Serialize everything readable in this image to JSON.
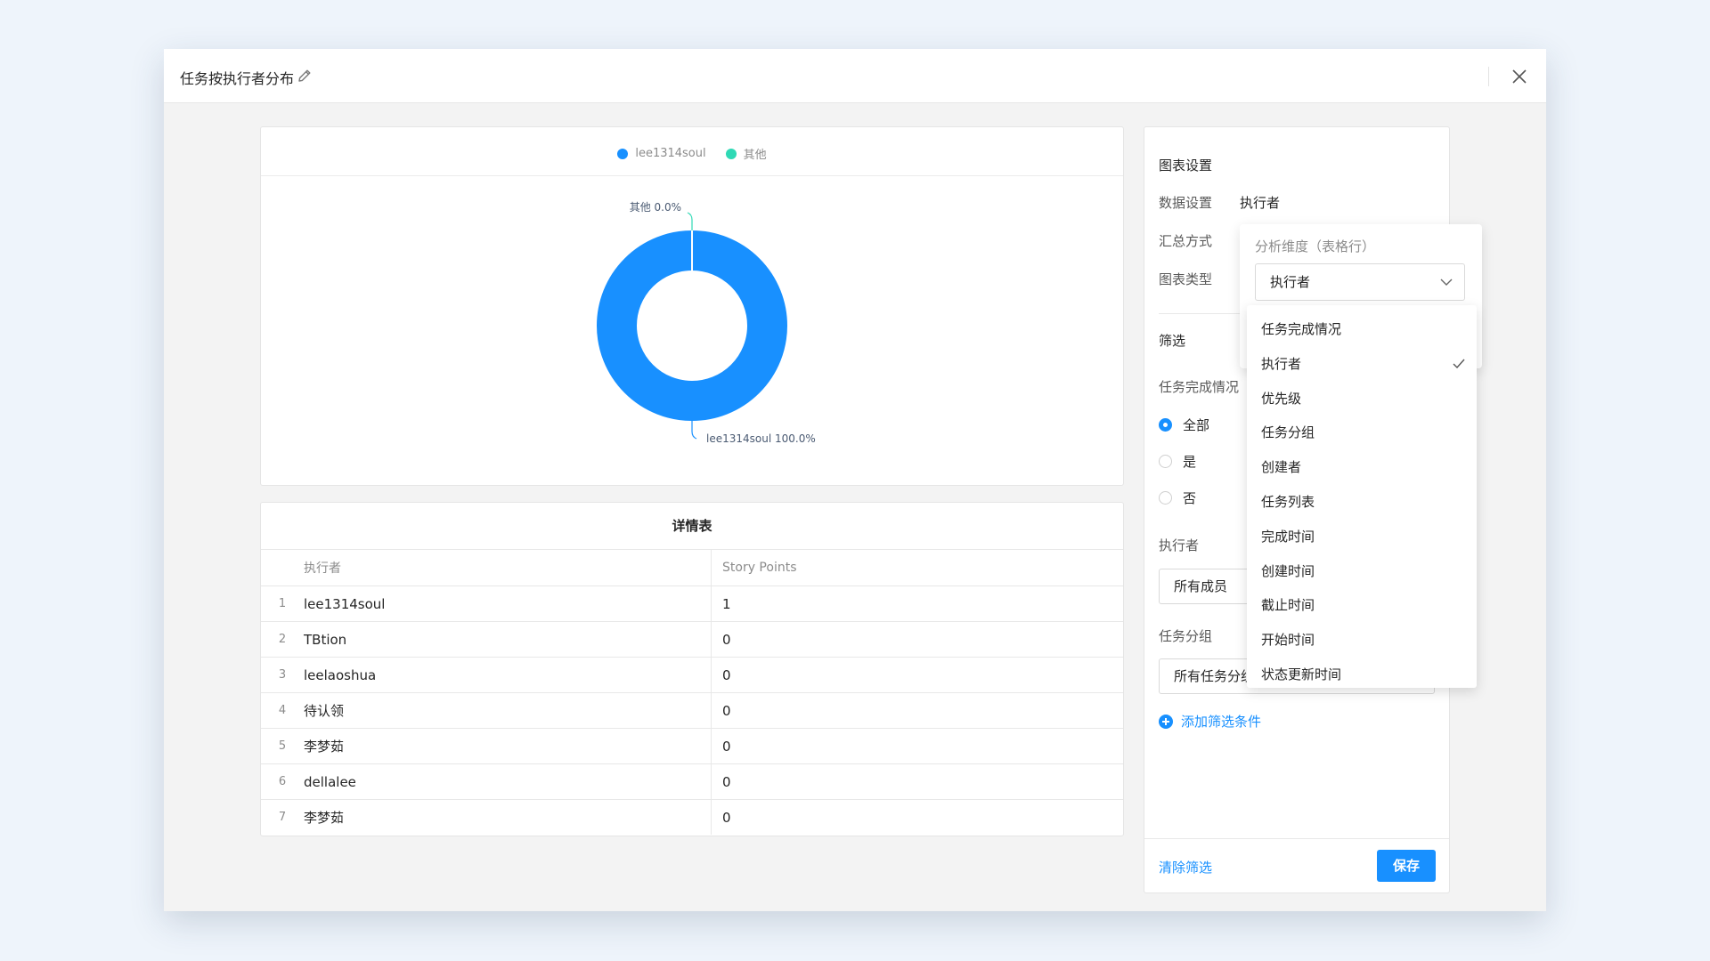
{
  "modal": {
    "title": "任务按执行者分布"
  },
  "legend": [
    {
      "label": "lee1314soul",
      "color": "#1890ff"
    },
    {
      "label": "其他",
      "color": "#2fd9b5"
    }
  ],
  "chart_data": {
    "type": "pie",
    "labels": [
      "lee1314soul",
      "其他"
    ],
    "values": [
      100.0,
      0.0
    ],
    "data_labels": [
      "lee1314soul 100.0%",
      "其他 0.0%"
    ],
    "colors": [
      "#1890ff",
      "#2fd9b5"
    ],
    "legend_position": "top"
  },
  "table": {
    "title": "详情表",
    "columns": [
      "执行者",
      "Story Points"
    ],
    "rows": [
      {
        "idx": "1",
        "name": "lee1314soul",
        "points": "1"
      },
      {
        "idx": "2",
        "name": "TBtion",
        "points": "0"
      },
      {
        "idx": "3",
        "name": "leelaoshua",
        "points": "0"
      },
      {
        "idx": "4",
        "name": "待认领",
        "points": "0"
      },
      {
        "idx": "5",
        "name": "李梦茹",
        "points": "0"
      },
      {
        "idx": "6",
        "name": "dellalee",
        "points": "0"
      },
      {
        "idx": "7",
        "name": "李梦茹",
        "points": "0"
      }
    ]
  },
  "settings": {
    "heading": "图表设置",
    "data_setting_label": "数据设置",
    "data_setting_value": "执行者",
    "aggregate_label": "汇总方式",
    "chart_type_label": "图表类型",
    "filter_heading": "筛选",
    "completion_label": "任务完成情况",
    "radios": [
      "全部",
      "是",
      "否"
    ],
    "assignee_label": "执行者",
    "assignee_value": "所有成员",
    "group_label": "任务分组",
    "group_value": "所有任务分组",
    "add_filter": "添加筛选条件",
    "clear": "清除筛选",
    "save": "保存"
  },
  "popover": {
    "label": "分析维度（表格行）",
    "selected": "执行者"
  },
  "dropdown": {
    "options": [
      "任务完成情况",
      "执行者",
      "优先级",
      "任务分组",
      "创建者",
      "任务列表",
      "完成时间",
      "创建时间",
      "截止时间",
      "开始时间",
      "状态更新时间"
    ],
    "checked": "执行者"
  },
  "icons": {
    "edit": "pencil-icon",
    "close": "close-icon",
    "chevron": "chevron-down-icon",
    "check": "check-icon",
    "plus": "plus-circle-icon"
  }
}
